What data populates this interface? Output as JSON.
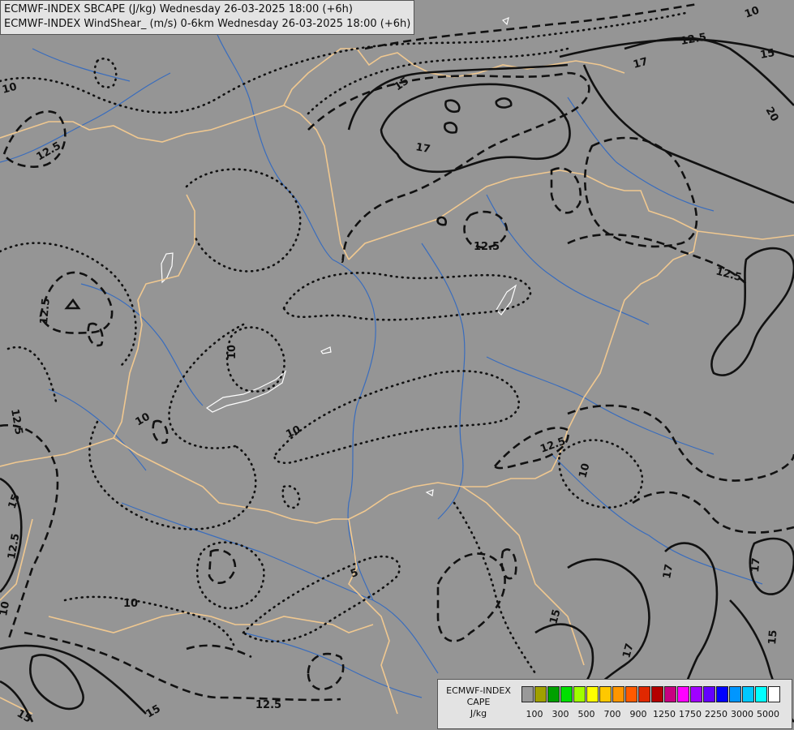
{
  "header": {
    "line1": "ECMWF-INDEX SBCAPE (J/kg) Wednesday 26-03-2025 18:00 (+6h)",
    "line2": "ECMWF-INDEX WindShear_ (m/s) 0-6km Wednesday 26-03-2025 18:00 (+6h)"
  },
  "legend": {
    "source": "ECMWF-INDEX",
    "field": "CAPE",
    "unit": "J/kg",
    "colors": [
      "#999999",
      "#a0a000",
      "#00a000",
      "#00e000",
      "#a0ff00",
      "#ffff00",
      "#ffc800",
      "#ff9600",
      "#ff5a00",
      "#e02800",
      "#b40000",
      "#c80080",
      "#ff00ff",
      "#a000ff",
      "#6400ff",
      "#0000ff",
      "#0096ff",
      "#00c8ff",
      "#00ffff",
      "#ffffff"
    ],
    "tick_labels": [
      "100",
      "300",
      "500",
      "700",
      "900",
      "1250",
      "1750",
      "2250",
      "3000",
      "5000"
    ]
  },
  "contour_labels": [
    "10",
    "12.5",
    "15",
    "17",
    "20",
    "5"
  ],
  "colors": {
    "background": "#959595",
    "borders": "#f0c890",
    "rivers": "#2a66c4",
    "lakes": "#ffffff",
    "contours": "#111111"
  }
}
